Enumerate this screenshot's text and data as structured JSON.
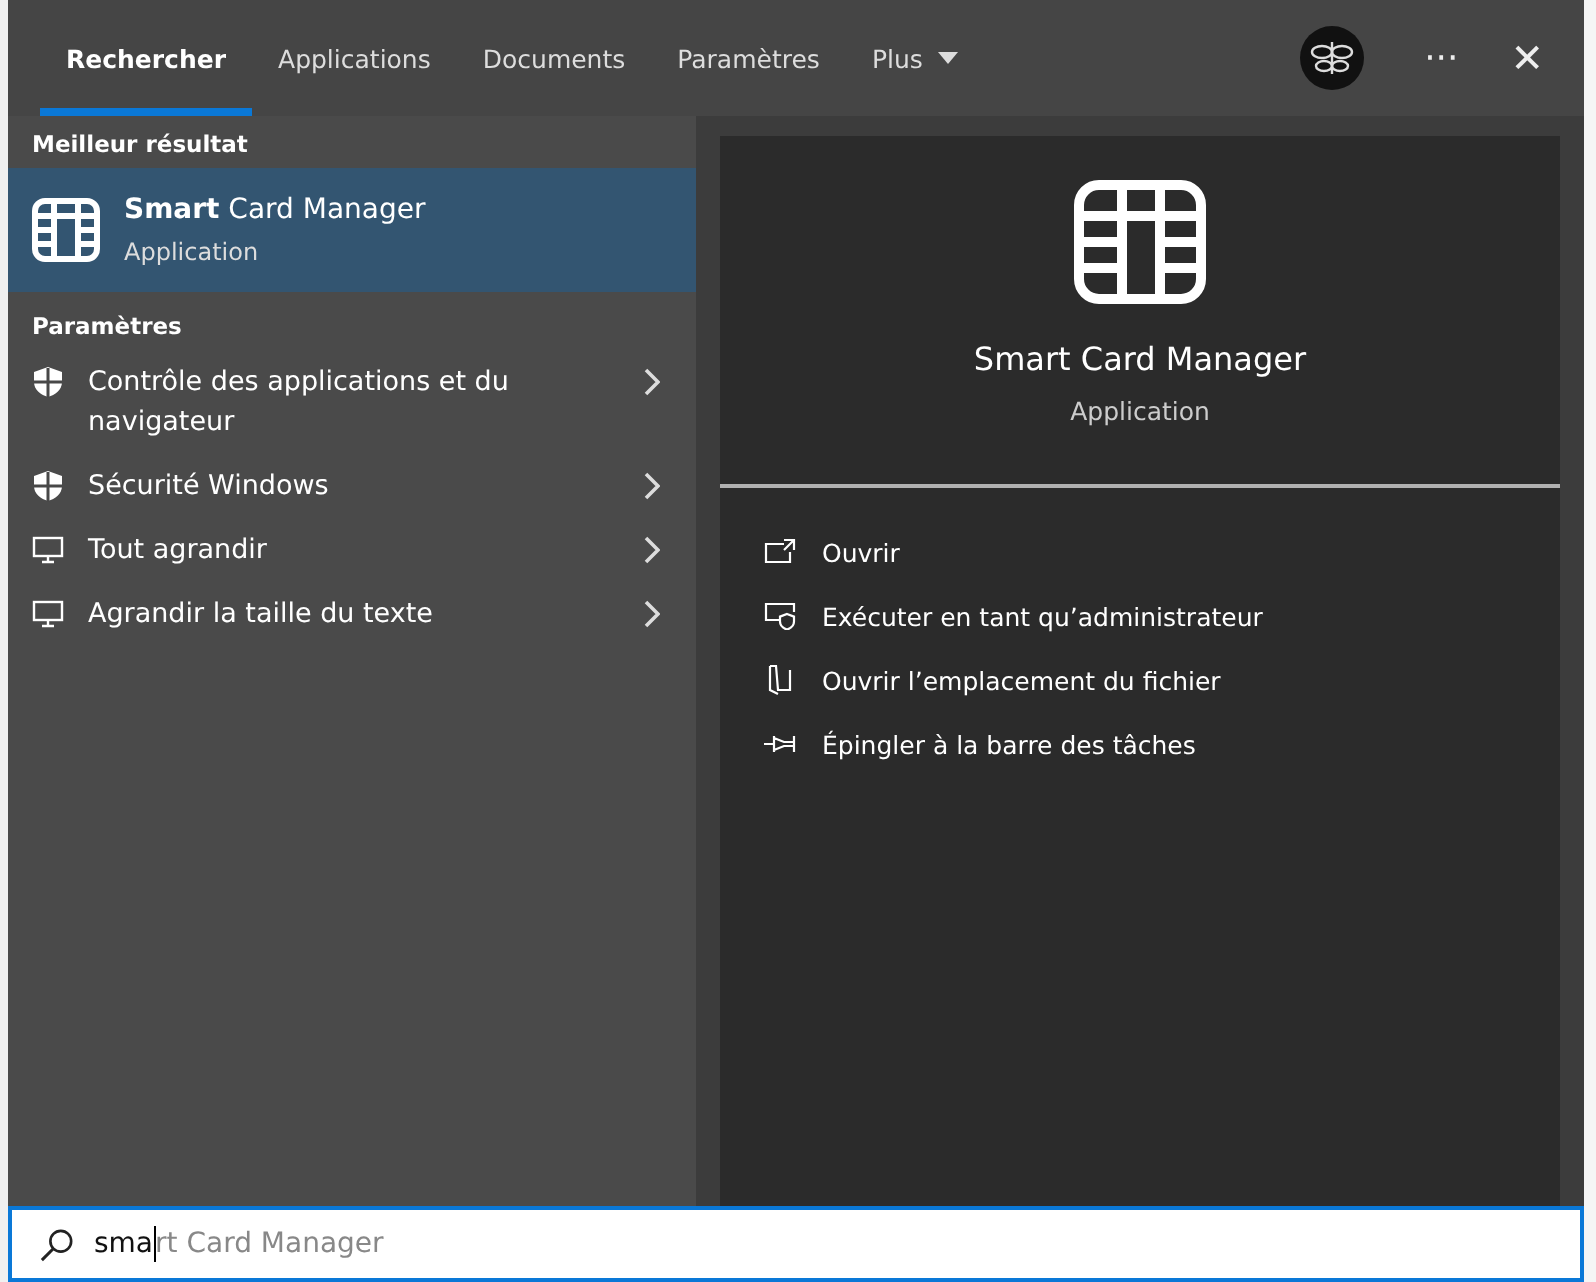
{
  "tabs": [
    {
      "label": "Rechercher",
      "selected": true
    },
    {
      "label": "Applications",
      "selected": false
    },
    {
      "label": "Documents",
      "selected": false
    },
    {
      "label": "Paramètres",
      "selected": false
    },
    {
      "label": "Plus",
      "selected": false,
      "dropdown": true
    }
  ],
  "toolbar": {
    "more": "···",
    "close": "✕"
  },
  "best_match": {
    "heading": "Meilleur résultat",
    "title": "**Smart** Card Manager",
    "subtitle": "Application",
    "selected": true
  },
  "settings": {
    "heading": "Paramètres",
    "items": [
      {
        "label": "Contrôle des applications et du navigateur",
        "kind": "shield"
      },
      {
        "label": "Sécurité Windows",
        "kind": "shield"
      },
      {
        "label": "Tout agrandir",
        "kind": "monitor"
      },
      {
        "label": "Agrandir la taille du texte",
        "kind": "monitor"
      }
    ]
  },
  "preview": {
    "title": "Smart Card Manager",
    "subtitle": "Application",
    "actions": [
      {
        "label": "Ouvrir",
        "kind": "open"
      },
      {
        "label": "Exécuter en tant qu’administrateur",
        "kind": "admin"
      },
      {
        "label": "Ouvrir l’emplacement du fichier",
        "kind": "folder"
      },
      {
        "label": "Épingler à la barre des tâches",
        "kind": "pin"
      }
    ]
  },
  "search": {
    "value": "sma",
    "suggestion": "rt Card Manager"
  }
}
